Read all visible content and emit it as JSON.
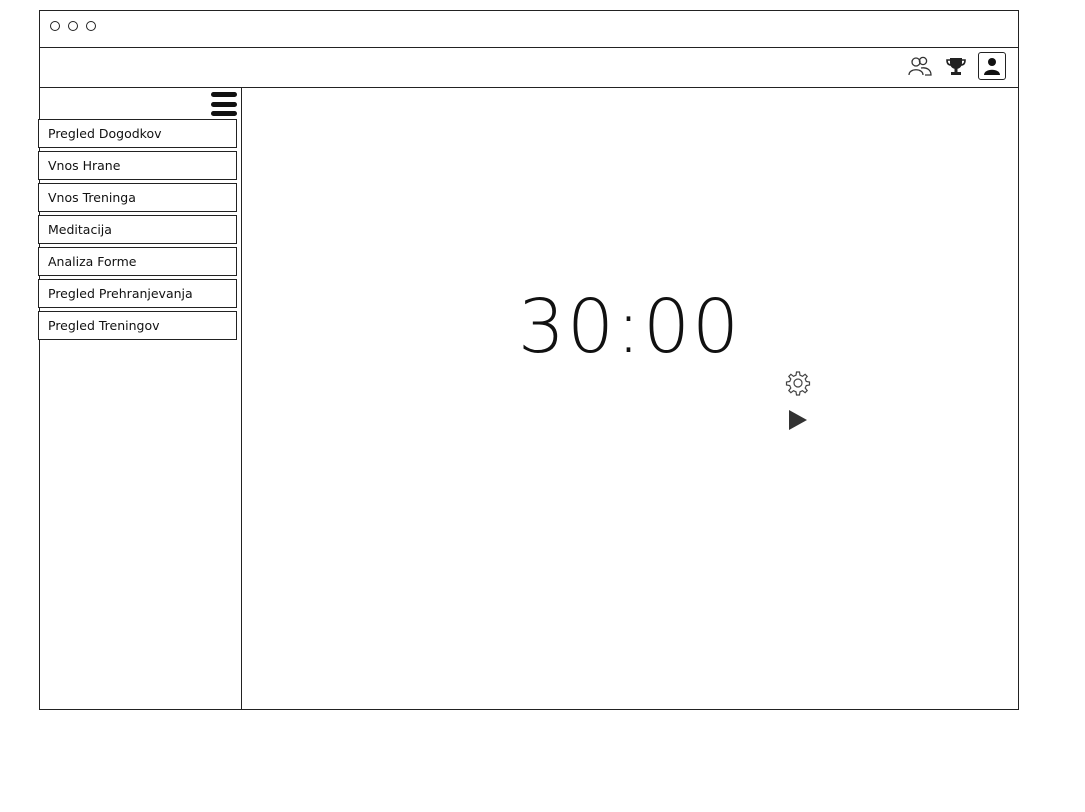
{
  "window": {
    "controls": [
      "dot",
      "dot",
      "dot"
    ]
  },
  "topbar": {
    "icons": [
      "users-icon",
      "trophy-icon",
      "profile-icon"
    ]
  },
  "sidebar": {
    "items": [
      {
        "label": "Pregled Dogodkov"
      },
      {
        "label": "Vnos Hrane"
      },
      {
        "label": "Vnos Treninga"
      },
      {
        "label": "Meditacija"
      },
      {
        "label": "Analiza Forme"
      },
      {
        "label": "Pregled Prehranjevanja"
      },
      {
        "label": "Pregled Treningov"
      }
    ]
  },
  "main": {
    "timer": "30:00"
  }
}
